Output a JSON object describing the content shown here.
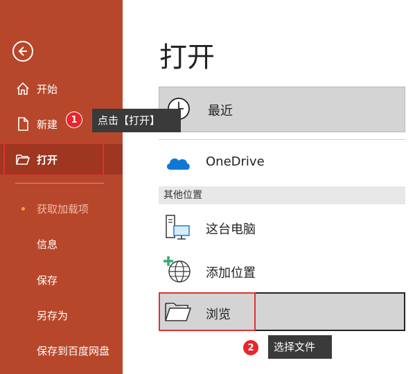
{
  "sidebar": {
    "items": [
      {
        "label": "开始"
      },
      {
        "label": "新建"
      },
      {
        "label": "打开"
      }
    ],
    "secondary": [
      {
        "label": "获取加载项"
      },
      {
        "label": "信息"
      },
      {
        "label": "保存"
      },
      {
        "label": "另存为"
      },
      {
        "label": "保存到百度网盘"
      }
    ]
  },
  "main": {
    "title": "打开",
    "rows": [
      {
        "label": "最近"
      },
      {
        "label": "OneDrive"
      }
    ],
    "section_header": "其他位置",
    "other_rows": [
      {
        "label": "这台电脑"
      },
      {
        "label": "添加位置"
      },
      {
        "label": "浏览"
      }
    ]
  },
  "annotations": {
    "step1": {
      "number": "1",
      "text": "点击【打开】"
    },
    "step2": {
      "number": "2",
      "text": "选择文件"
    }
  },
  "colors": {
    "sidebar_bg": "#b7472a",
    "sidebar_active": "#9e3620",
    "highlight_red": "#e03030",
    "onedrive_blue": "#0f78d4"
  }
}
